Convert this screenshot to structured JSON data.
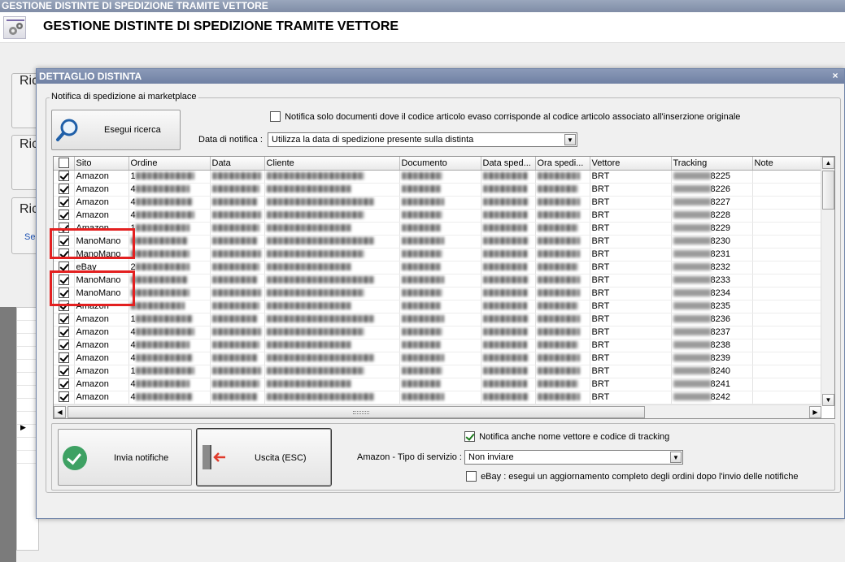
{
  "main_window": {
    "title": "GESTIONE DISTINTE DI SPEDIZIONE TRAMITE VETTORE",
    "header_title": "GESTIONE DISTINTE DI SPEDIZIONE TRAMITE VETTORE",
    "bg_labels": [
      "Ric",
      "Ric",
      "Ric",
      "Se"
    ]
  },
  "dialog": {
    "title": "DETTAGLIO DISTINTA",
    "close": "×",
    "group_label": "Notifica di spedizione ai marketplace",
    "search_button": "Esegui ricerca",
    "only_matching_check": {
      "label": "Notifica solo documenti dove il codice articolo evaso corrisponde al codice articolo associato all'inserzione originale",
      "checked": false
    },
    "data_notifica_label": "Data di notifica :",
    "data_notifica_value": "Utilizza la data di spedizione presente sulla distinta",
    "columns": [
      "",
      "Sito",
      "Ordine",
      "Data",
      "Cliente",
      "Documento",
      "Data sped...",
      "Ora spedi...",
      "Vettore",
      "Tracking",
      "Note"
    ],
    "rows": [
      {
        "sito": "Amazon",
        "ordine": "1",
        "vettore": "BRT",
        "tracking": "8225"
      },
      {
        "sito": "Amazon",
        "ordine": "4",
        "vettore": "BRT",
        "tracking": "8226"
      },
      {
        "sito": "Amazon",
        "ordine": "4",
        "vettore": "BRT",
        "tracking": "8227"
      },
      {
        "sito": "Amazon",
        "ordine": "4",
        "vettore": "BRT",
        "tracking": "8228"
      },
      {
        "sito": "Amazon",
        "ordine": "1",
        "vettore": "BRT",
        "tracking": "8229"
      },
      {
        "sito": "ManoMano",
        "ordine": "",
        "vettore": "BRT",
        "tracking": "8230"
      },
      {
        "sito": "ManoMano",
        "ordine": "",
        "vettore": "BRT",
        "tracking": "8231"
      },
      {
        "sito": "eBay",
        "ordine": "2",
        "vettore": "BRT",
        "tracking": "8232"
      },
      {
        "sito": "ManoMano",
        "ordine": "",
        "vettore": "BRT",
        "tracking": "8233"
      },
      {
        "sito": "ManoMano",
        "ordine": "",
        "vettore": "BRT",
        "tracking": "8234"
      },
      {
        "sito": "Amazon",
        "ordine": "",
        "vettore": "BRT",
        "tracking": "8235"
      },
      {
        "sito": "Amazon",
        "ordine": "1",
        "vettore": "BRT",
        "tracking": "8236"
      },
      {
        "sito": "Amazon",
        "ordine": "4",
        "vettore": "BRT",
        "tracking": "8237"
      },
      {
        "sito": "Amazon",
        "ordine": "4",
        "vettore": "BRT",
        "tracking": "8238"
      },
      {
        "sito": "Amazon",
        "ordine": "4",
        "vettore": "BRT",
        "tracking": "8239"
      },
      {
        "sito": "Amazon",
        "ordine": "1",
        "vettore": "BRT",
        "tracking": "8240"
      },
      {
        "sito": "Amazon",
        "ordine": "4",
        "vettore": "BRT",
        "tracking": "8241"
      },
      {
        "sito": "Amazon",
        "ordine": "4",
        "vettore": "BRT",
        "tracking": "8242"
      }
    ],
    "send_button": "Invia notifiche",
    "exit_button": "Uscita (ESC)",
    "notify_carrier_check": {
      "label": "Notifica anche nome vettore e codice di tracking",
      "checked": true
    },
    "amazon_service_label": "Amazon - Tipo di servizio :",
    "amazon_service_value": "Non inviare",
    "ebay_check": {
      "label": "eBay : esegui un aggiornamento completo degli ordini dopo l'invio delle notifiche",
      "checked": false
    }
  }
}
